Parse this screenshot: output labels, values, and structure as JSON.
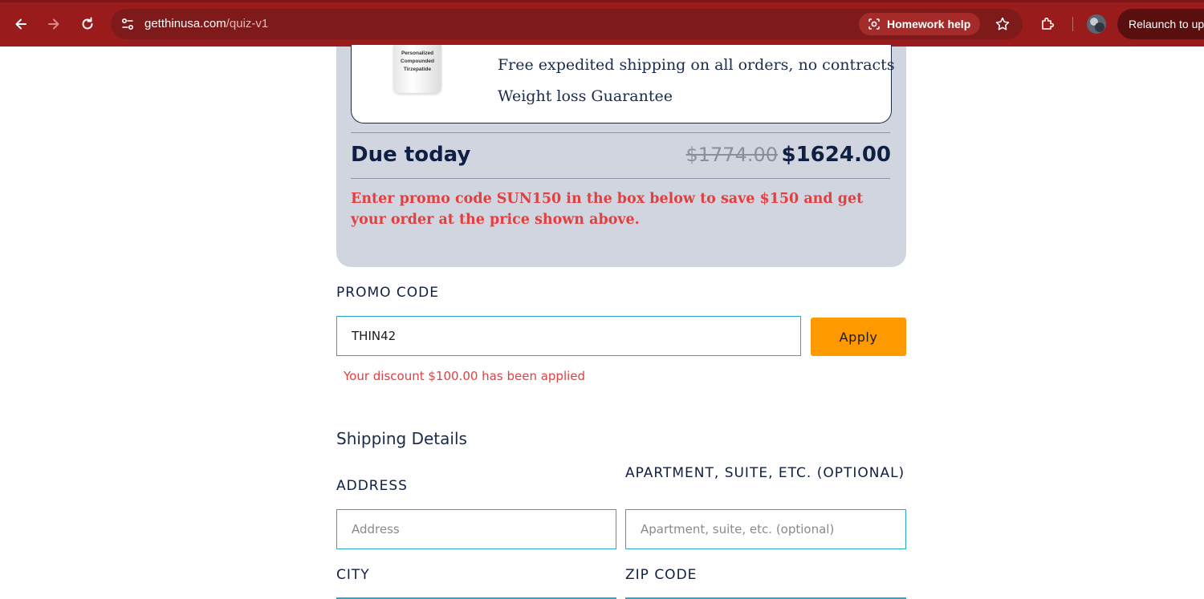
{
  "browser": {
    "url_host": "getthinusa.com",
    "url_path": "/quiz-v1",
    "homework_help_label": "Homework help",
    "relaunch_label": "Relaunch to update"
  },
  "product": {
    "bottle_label": [
      "Personalized",
      "Compounded",
      "Tirzepatide"
    ],
    "features": [
      "Free expedited shipping on all orders, no contracts",
      "Weight loss Guarantee"
    ]
  },
  "summary": {
    "due_label": "Due today",
    "original_price": "$1774.00",
    "discounted_price": "$1624.00",
    "promo_message": "Enter promo code SUN150 in the box below to save $150 and get your order at the price shown above."
  },
  "promo": {
    "label": "PROMO CODE",
    "value": "THIN42",
    "apply_label": "Apply",
    "success_message": "Your discount $100.00 has been applied"
  },
  "shipping": {
    "title": "Shipping Details",
    "address_label": "ADDRESS",
    "address_placeholder": "Address",
    "apartment_label": "APARTMENT, SUITE, ETC. (OPTIONAL)",
    "apartment_placeholder": "Apartment, suite, etc. (optional)",
    "city_label": "CITY",
    "zip_label": "ZIP CODE"
  },
  "colors": {
    "chrome": "#9a1b1b",
    "card_background": "#d1d5df",
    "navy_text": "#0f1f44",
    "alert_red": "#e04040",
    "apply_orange": "#ff9900",
    "input_border": "#2aa8c9"
  }
}
